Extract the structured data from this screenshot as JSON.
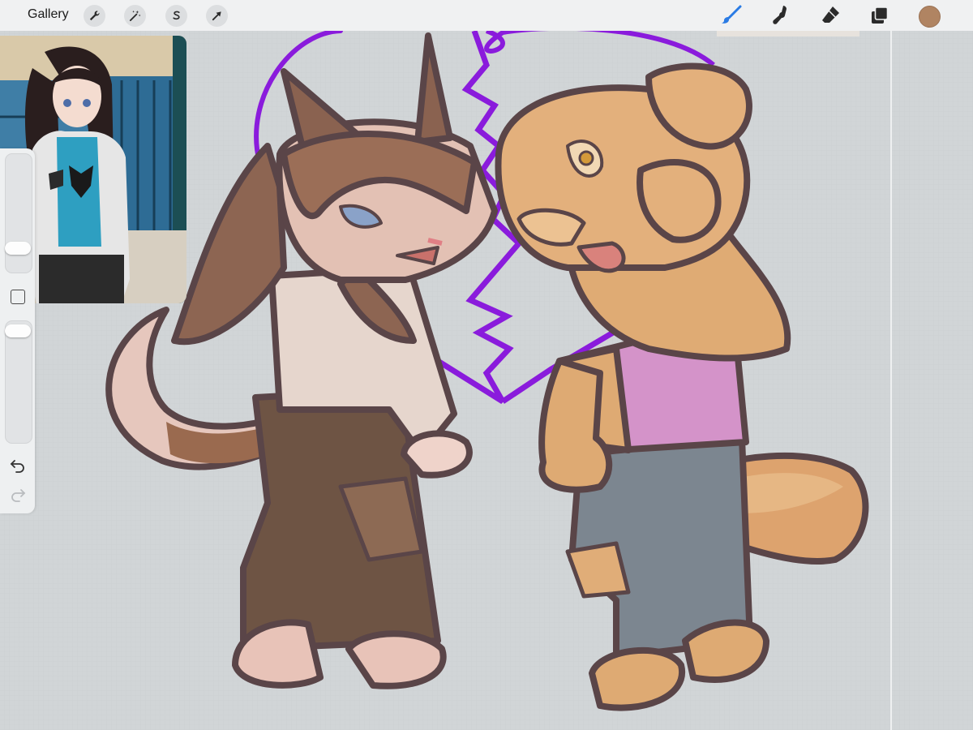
{
  "app": {
    "gallery_label": "Gallery"
  },
  "toolbar_left": [
    {
      "name": "actions-wrench-icon"
    },
    {
      "name": "adjustments-wand-icon"
    },
    {
      "name": "selection-s-icon"
    },
    {
      "name": "transform-arrow-icon"
    }
  ],
  "toolbar_right": [
    {
      "name": "brush-icon",
      "active": true
    },
    {
      "name": "smudge-icon"
    },
    {
      "name": "eraser-icon"
    },
    {
      "name": "layers-icon"
    }
  ],
  "colors": {
    "current_color": "#b08462",
    "active_tool": "#2a7be4",
    "canvas_bg": "#d1d5d7",
    "heart_outline": "#8a1bdc"
  },
  "sidebar": {
    "brush_size_level": 0.22,
    "opacity_level": 0.05
  },
  "reference": {
    "refresh_icon": "refresh-icon"
  }
}
